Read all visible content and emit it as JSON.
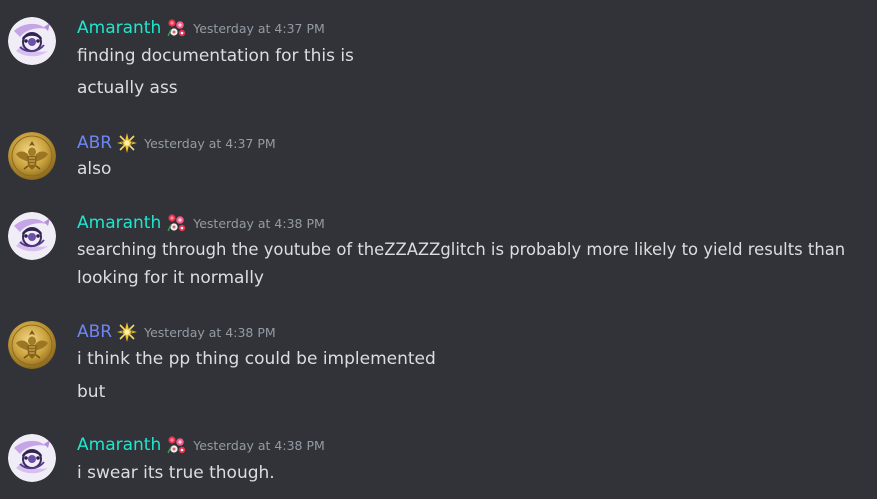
{
  "colors": {
    "background": "#313338",
    "amaranth": "#1ee6cf",
    "abr": "#6f86f4",
    "timestamp": "#949ba4",
    "message_text": "#dbdee1"
  },
  "messages": [
    {
      "author": "Amaranth",
      "author_icon": "rose-cluster-icon",
      "avatar": "purple-swirl-avatar",
      "timestamp": "Yesterday at 4:37 PM",
      "lines": [
        "finding documentation for this is",
        "actually ass"
      ]
    },
    {
      "author": "ABR",
      "author_icon": "sparkle-star-icon",
      "avatar": "gold-eagle-seal-avatar",
      "timestamp": "Yesterday at 4:37 PM",
      "lines": [
        "also"
      ]
    },
    {
      "author": "Amaranth",
      "author_icon": "rose-cluster-icon",
      "avatar": "purple-swirl-avatar",
      "timestamp": "Yesterday at 4:38 PM",
      "lines": [
        "searching through the youtube of theZZAZZglitch is probably more likely to yield results than",
        "looking for it normally"
      ]
    },
    {
      "author": "ABR",
      "author_icon": "sparkle-star-icon",
      "avatar": "gold-eagle-seal-avatar",
      "timestamp": "Yesterday at 4:38 PM",
      "lines": [
        "i think the pp thing could be implemented",
        "but"
      ]
    },
    {
      "author": "Amaranth",
      "author_icon": "rose-cluster-icon",
      "avatar": "purple-swirl-avatar",
      "timestamp": "Yesterday at 4:38 PM",
      "lines": [
        "i swear its true though."
      ]
    }
  ]
}
